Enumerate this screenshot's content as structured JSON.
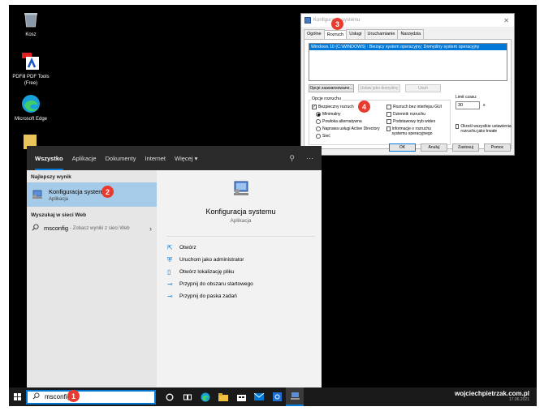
{
  "desktop": {
    "icons": [
      {
        "label": "Kosz",
        "icon": "recycle-bin-icon"
      },
      {
        "label": "PDFill PDF Tools (Free)",
        "icon": "pdfill-icon"
      },
      {
        "label": "Microsoft Edge",
        "icon": "edge-icon"
      }
    ]
  },
  "msconfig": {
    "title": "Konfiguracja systemu",
    "tabs": [
      "Ogólne",
      "Rozruch",
      "Usługi",
      "Uruchamianie",
      "Narzędzia"
    ],
    "active_tab": "Rozruch",
    "os_entry": "Windows 10 (C:\\WINDOWS) : Bieżący system operacyjny; Domyślny system operacyjny",
    "buttons": {
      "advanced": "Opcje zaawansowane...",
      "set_default": "Ustaw jako domyślny",
      "delete": "Usuń"
    },
    "boot_options_label": "Opcje rozruchu",
    "safe_boot": "Bezpieczny rozruch",
    "radio_minimal": "Minimalny",
    "radio_shell": "Powłoka alternatywna",
    "radio_ad": "Naprawa usługi Active Directory",
    "radio_network": "Sieć",
    "no_gui": "Rozruch bez interfejsu GUI",
    "boot_log": "Dziennik rozruchu",
    "base_video": "Podstawowy tryb wideo",
    "os_info": "Informacje o rozruchu systemu operacyjnego",
    "timeout_label": "Limit czasu:",
    "timeout_value": "30",
    "timeout_unit": "s",
    "permanent": "Określ wszystkie ustawienia rozruchu jako trwałe",
    "ok": "OK",
    "cancel": "Anuluj",
    "apply": "Zastosuj",
    "help": "Pomoc"
  },
  "start_menu": {
    "tabs": [
      "Wszystko",
      "Aplikacje",
      "Dokumenty",
      "Internet",
      "Więcej ▾"
    ],
    "best_match_header": "Najlepszy wynik",
    "best_title": "Konfiguracja systemu",
    "best_sub": "Aplikacja",
    "web_header": "Wyszukaj w sieci Web",
    "web_query": "msconfig",
    "web_hint": "- Zobacz wyniki z sieci Web",
    "detail_title": "Konfiguracja systemu",
    "detail_sub": "Aplikacja",
    "actions": [
      "Otwórz",
      "Uruchom jako administrator",
      "Otwórz lokalizację pliku",
      "Przypnij do obszaru startowego",
      "Przypnij do paska zadań"
    ]
  },
  "taskbar": {
    "search_value": "msconfig",
    "watermark": "wojciechpietrzak.com.pl",
    "tray_sub": "17.06.2021"
  },
  "badges": [
    "1",
    "2",
    "3",
    "4"
  ],
  "colors": {
    "accent": "#0078d7",
    "badge": "#e83a2f",
    "selection": "#a5cbe8"
  }
}
